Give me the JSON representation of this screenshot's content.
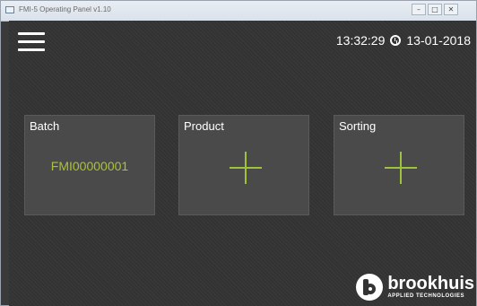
{
  "window": {
    "title": "FMI-5 Operating Panel v1.10",
    "controls": {
      "minimize": "–",
      "maximize": "□",
      "close": "✕"
    }
  },
  "header": {
    "menu_icon": "hamburger-menu-icon",
    "time": "13:32:29",
    "clock_icon": "clock-icon",
    "date": "13-01-2018"
  },
  "tiles": [
    {
      "label": "Batch",
      "value": "FMI00000001"
    },
    {
      "label": "Product",
      "icon": "plus-icon"
    },
    {
      "label": "Sorting",
      "icon": "plus-icon"
    }
  ],
  "brand": {
    "name": "brookhuis",
    "tagline": "APPLIED TECHNOLOGIES"
  },
  "colors": {
    "background": "#333333",
    "tile": "#4a4a4a",
    "accent_green": "#9ec23a",
    "text": "#ffffff"
  }
}
